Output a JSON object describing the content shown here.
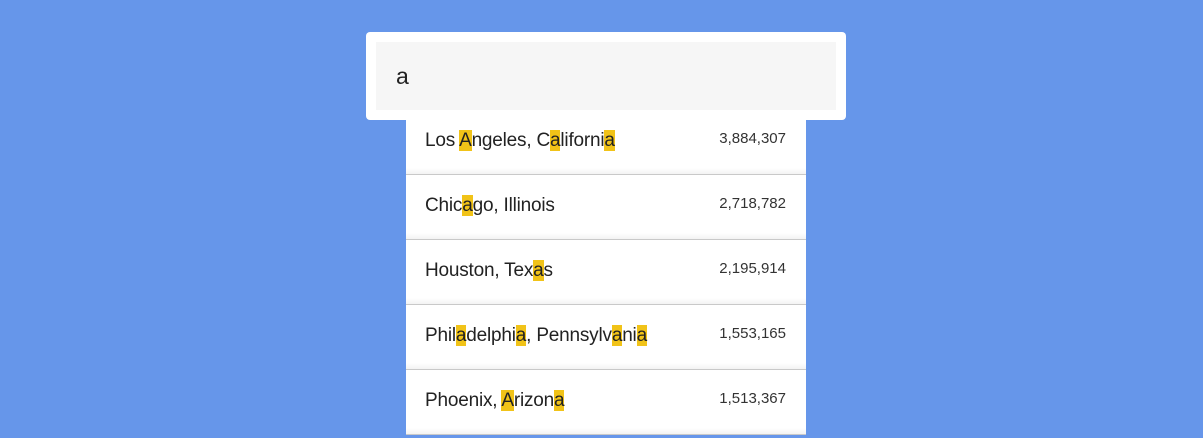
{
  "search": {
    "value": "a",
    "placeholder": ""
  },
  "colors": {
    "background": "#6696ea",
    "highlight": "#f1c318"
  },
  "results": [
    {
      "segments": [
        {
          "t": "Los ",
          "h": false
        },
        {
          "t": "A",
          "h": true
        },
        {
          "t": "ngeles, C",
          "h": false
        },
        {
          "t": "a",
          "h": true
        },
        {
          "t": "liforni",
          "h": false
        },
        {
          "t": "a",
          "h": true
        }
      ],
      "population": "3,884,307"
    },
    {
      "segments": [
        {
          "t": "Chic",
          "h": false
        },
        {
          "t": "a",
          "h": true
        },
        {
          "t": "go, Illinois",
          "h": false
        }
      ],
      "population": "2,718,782"
    },
    {
      "segments": [
        {
          "t": "Houston, Tex",
          "h": false
        },
        {
          "t": "a",
          "h": true
        },
        {
          "t": "s",
          "h": false
        }
      ],
      "population": "2,195,914"
    },
    {
      "segments": [
        {
          "t": "Phil",
          "h": false
        },
        {
          "t": "a",
          "h": true
        },
        {
          "t": "delphi",
          "h": false
        },
        {
          "t": "a",
          "h": true
        },
        {
          "t": ", Pennsylv",
          "h": false
        },
        {
          "t": "a",
          "h": true
        },
        {
          "t": "ni",
          "h": false
        },
        {
          "t": "a",
          "h": true
        }
      ],
      "population": "1,553,165"
    },
    {
      "segments": [
        {
          "t": "Phoenix, ",
          "h": false
        },
        {
          "t": "A",
          "h": true
        },
        {
          "t": "rizon",
          "h": false
        },
        {
          "t": "a",
          "h": true
        }
      ],
      "population": "1,513,367"
    }
  ]
}
